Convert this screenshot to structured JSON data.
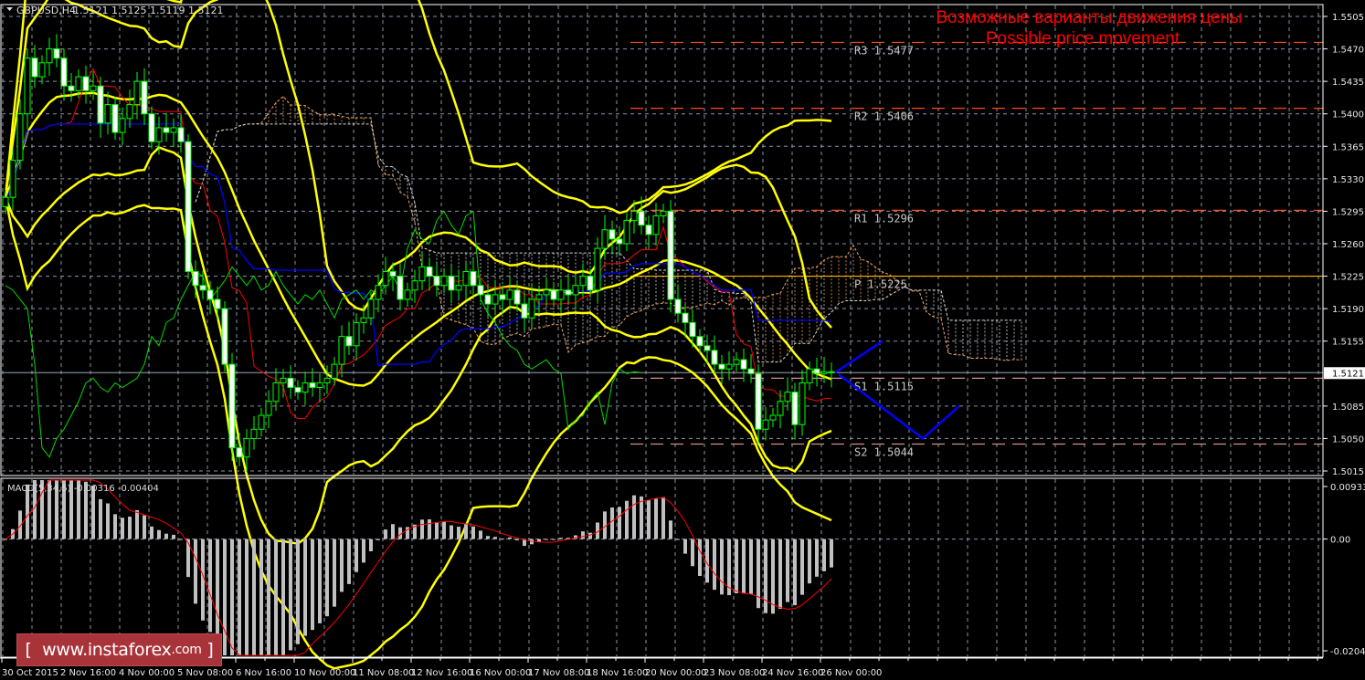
{
  "header": {
    "symbol": "GBPUSD,H4",
    "ohlc": "1.5121 1.5125 1.5119 1.5121",
    "menu_icon": "triangle-down-icon"
  },
  "annotation": {
    "line1": "Возможные варианты движения цены",
    "line2": "Possible price movement"
  },
  "logo": {
    "text": "[ www.instaforex.com ]"
  },
  "colors": {
    "background": "#000000",
    "candle_bull": "#00ff00",
    "candle_body_up": "#ffffff",
    "bollinger": "#ffff00",
    "tenkan": "#ff0000",
    "kijun": "#0000ff",
    "chikou": "#00dd00",
    "cloud_a": "#f4a460",
    "cloud_b": "#d8d8d8",
    "pivot_r": "#ff4a1a",
    "pivot_p": "#ffb000",
    "pivot_s": "#d09090",
    "forecast": "#0000ff",
    "macd_hist": "#c0c0c0",
    "macd_signal": "#ff0000",
    "annotation": "#ff0000"
  },
  "chart_data": {
    "type": "candlestick",
    "symbol": "GBPUSD",
    "timeframe": "H4",
    "price_axis": {
      "ylim": [
        1.5015,
        1.5505
      ],
      "ticks": [
        "1.5505",
        "1.5470",
        "1.5435",
        "1.5400",
        "1.5365",
        "1.5330",
        "1.5295",
        "1.5260",
        "1.5225",
        "1.5190",
        "1.5155",
        "1.5085",
        "1.5050",
        "1.5015"
      ],
      "current_price": "1.5121"
    },
    "time_axis": {
      "bars_per_label": 8,
      "labels": [
        "30 Oct 2015",
        "2 Nov 16:00",
        "4 Nov 00:00",
        "5 Nov 08:00",
        "6 Nov 16:00",
        "10 Nov 00:00",
        "11 Nov 08:00",
        "12 Nov 16:00",
        "16 Nov 00:00",
        "17 Nov 08:00",
        "18 Nov 16:00",
        "20 Nov 00:00",
        "23 Nov 08:00",
        "24 Nov 16:00",
        "26 Nov 00:00"
      ]
    },
    "close": [
      1.531,
      1.535,
      1.54,
      1.546,
      1.544,
      1.5455,
      1.547,
      1.546,
      1.543,
      1.5425,
      1.544,
      1.5425,
      1.543,
      1.539,
      1.541,
      1.538,
      1.5395,
      1.541,
      1.5435,
      1.54,
      1.537,
      1.5385,
      1.538,
      1.5385,
      1.537,
      1.523,
      1.5215,
      1.521,
      1.52,
      1.519,
      1.513,
      1.504,
      1.503,
      1.505,
      1.506,
      1.5075,
      1.509,
      1.511,
      1.5115,
      1.5105,
      1.51,
      1.511,
      1.5105,
      1.511,
      1.5115,
      1.513,
      1.516,
      1.515,
      1.5175,
      1.518,
      1.52,
      1.5215,
      1.523,
      1.5225,
      1.52,
      1.521,
      1.522,
      1.5235,
      1.5225,
      1.5215,
      1.5225,
      1.521,
      1.5215,
      1.523,
      1.5215,
      1.5205,
      1.5195,
      1.5205,
      1.52,
      1.521,
      1.5195,
      1.518,
      1.52,
      1.5205,
      1.521,
      1.52,
      1.521,
      1.5205,
      1.5215,
      1.5225,
      1.521,
      1.5255,
      1.5275,
      1.5265,
      1.526,
      1.5285,
      1.5295,
      1.528,
      1.527,
      1.529,
      1.5295,
      1.52,
      1.5185,
      1.5175,
      1.516,
      1.515,
      1.5145,
      1.513,
      1.5125,
      1.513,
      1.5135,
      1.5125,
      1.512,
      1.506,
      1.507,
      1.5075,
      1.509,
      1.51,
      1.5065,
      1.511,
      1.5125,
      1.512,
      1.5122,
      1.5121
    ],
    "first_open": 1.53,
    "indicators": {
      "bollinger": [
        {
          "period": 20,
          "deviation": 2
        },
        {
          "period": 40,
          "deviation": 3
        }
      ],
      "ichimoku": {
        "tenkan": 9,
        "kijun": 26,
        "senkou": 52
      },
      "macd": {
        "label": "MACD(5,34,5) -0.00316 -0.00404",
        "fast": 5,
        "slow": 34,
        "signal": 5,
        "ylim": [
          -0.02049,
          0.00933
        ],
        "ticks": [
          "0.00933",
          "0.00",
          "-0.02049"
        ]
      }
    },
    "pivots": [
      {
        "name": "R3",
        "label": "R3 1.5477",
        "value": 1.5477,
        "kind": "r"
      },
      {
        "name": "R2",
        "label": "R2 1.5406",
        "value": 1.5406,
        "kind": "r"
      },
      {
        "name": "R1",
        "label": "R1 1.5296",
        "value": 1.5296,
        "kind": "r"
      },
      {
        "name": "P",
        "label": "P  1.5225",
        "value": 1.5225,
        "kind": "p"
      },
      {
        "name": "S1",
        "label": "S1 1.5115",
        "value": 1.5115,
        "kind": "s"
      },
      {
        "name": "S2",
        "label": "S2 1.5044",
        "value": 1.5044,
        "kind": "s"
      }
    ],
    "forecast_paths": [
      [
        [
          113.5,
          1.5121
        ],
        [
          120,
          1.5155
        ]
      ],
      [
        [
          114,
          1.5119
        ],
        [
          125.5,
          1.505
        ],
        [
          130.5,
          1.5085
        ]
      ]
    ]
  }
}
